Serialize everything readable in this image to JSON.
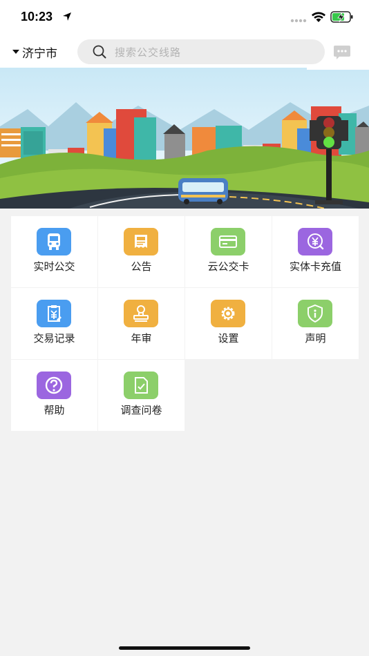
{
  "status_bar": {
    "time": "10:23"
  },
  "header": {
    "city": "济宁市",
    "search_placeholder": "搜索公交线路"
  },
  "menu": [
    {
      "label": "实时公交",
      "icon": "bus-icon",
      "color": "#4a9df0"
    },
    {
      "label": "公告",
      "icon": "announcement-icon",
      "color": "#f0b040"
    },
    {
      "label": "云公交卡",
      "icon": "card-icon",
      "color": "#8ccf6a"
    },
    {
      "label": "实体卡充值",
      "icon": "recharge-icon",
      "color": "#9b66e0"
    },
    {
      "label": "交易记录",
      "icon": "transaction-record-icon",
      "color": "#4a9df0"
    },
    {
      "label": "年审",
      "icon": "stamp-icon",
      "color": "#f0b040"
    },
    {
      "label": "设置",
      "icon": "gear-icon",
      "color": "#f0b040"
    },
    {
      "label": "声明",
      "icon": "shield-icon",
      "color": "#8ccf6a"
    },
    {
      "label": "帮助",
      "icon": "help-icon",
      "color": "#9b66e0"
    },
    {
      "label": "调查问卷",
      "icon": "survey-icon",
      "color": "#8ccf6a"
    }
  ]
}
